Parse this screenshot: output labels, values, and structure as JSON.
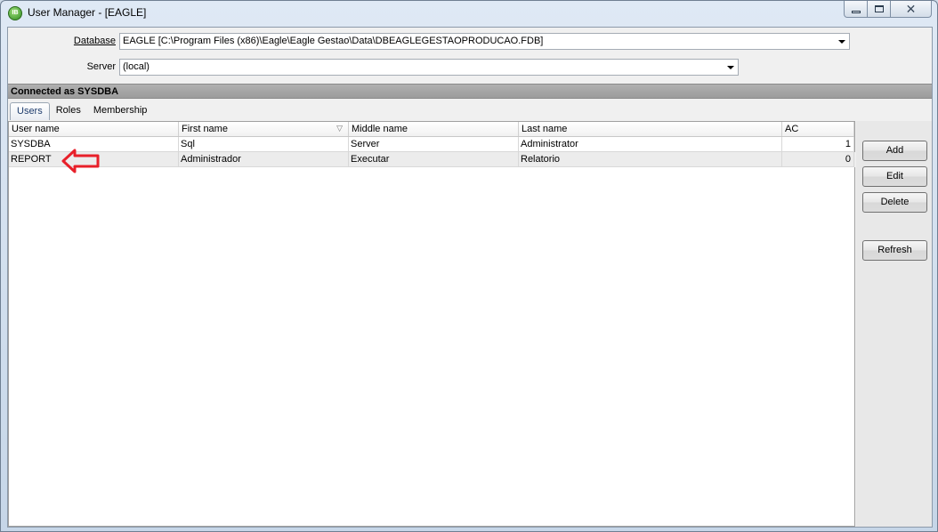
{
  "window": {
    "title": "User Manager - [EAGLE]",
    "app_icon_text": "IB",
    "close_glyph": "✕"
  },
  "form": {
    "database_label": "Database",
    "database_value": "EAGLE [C:\\Program Files (x86)\\Eagle\\Eagle Gestao\\Data\\DBEAGLEGESTAOPRODUCAO.FDB]",
    "server_label": "Server",
    "server_value": "(local)"
  },
  "status": {
    "connected_text": "Connected as SYSDBA"
  },
  "tabs": [
    {
      "label": "Users",
      "active": true
    },
    {
      "label": "Roles",
      "active": false
    },
    {
      "label": "Membership",
      "active": false
    }
  ],
  "grid": {
    "columns": [
      "User name",
      "First name",
      "Middle name",
      "Last name",
      "AC"
    ],
    "sort_glyph": "▽",
    "rows": [
      {
        "user_name": "SYSDBA",
        "first_name": "Sql",
        "middle_name": "Server",
        "last_name": "Administrator",
        "ac": "1"
      },
      {
        "user_name": "REPORT",
        "first_name": "Administrador",
        "middle_name": "Executar",
        "last_name": "Relatorio",
        "ac": "0"
      }
    ]
  },
  "buttons": {
    "add": "Add",
    "edit": "Edit",
    "delete": "Delete",
    "refresh": "Refresh"
  },
  "colors": {
    "annotation_arrow": "#e8202a",
    "title_bar": "#dfe9f5",
    "connected_bar": "#a8a8a8"
  }
}
